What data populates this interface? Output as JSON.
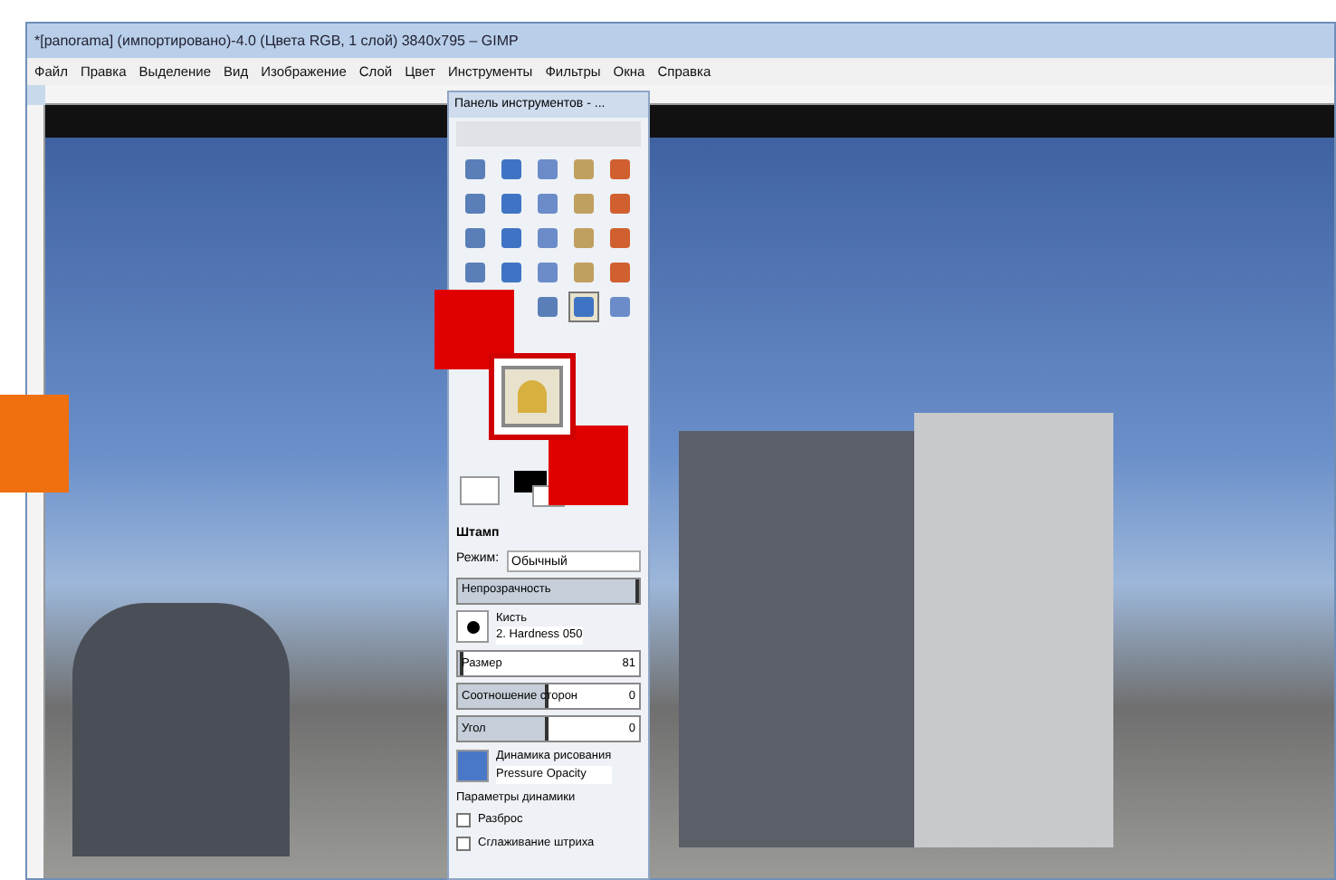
{
  "window": {
    "title": "*[panorama] (импортировано)-4.0 (Цвета RGB, 1 слой) 3840x795 – GIMP"
  },
  "menu": [
    "Файл",
    "Правка",
    "Выделение",
    "Вид",
    "Изображение",
    "Слой",
    "Цвет",
    "Инструменты",
    "Фильтры",
    "Окна",
    "Справка"
  ],
  "toolbox": {
    "title": "Панель инструментов - ...",
    "tools": [
      {
        "selected": false
      },
      {
        "selected": false
      },
      {
        "selected": false
      },
      {
        "selected": false
      },
      {
        "selected": false
      },
      {
        "selected": false
      },
      {
        "selected": false
      },
      {
        "selected": false
      },
      {
        "selected": false
      },
      {
        "selected": false
      },
      {
        "selected": false
      },
      {
        "selected": false
      },
      {
        "selected": false
      },
      {
        "selected": false
      },
      {
        "selected": false
      },
      {
        "selected": false
      },
      {
        "selected": false
      },
      {
        "selected": false
      },
      {
        "selected": false
      },
      {
        "selected": false
      },
      {
        "selected": false
      },
      {
        "selected": true
      },
      {
        "selected": false
      }
    ],
    "tool_options": {
      "title": "Штамп",
      "mode_label": "Режим:",
      "mode_value": "Обычный",
      "rows": [
        {
          "kind": "slider",
          "label": "Непрозрачность",
          "level": 1
        },
        {
          "kind": "brush",
          "label": "Кисть",
          "value": "2. Hardness 050"
        },
        {
          "kind": "slider",
          "label": "Размер",
          "level": 0.03,
          "reading": "81"
        },
        {
          "kind": "slider",
          "label": "Соотношение сторон",
          "level": 0.5,
          "reading": "0"
        },
        {
          "kind": "slider",
          "label": "Угол",
          "level": 0.5,
          "reading": "0"
        },
        {
          "kind": "dynamics",
          "label": "Динамика рисования",
          "value": "Pressure Opacity"
        },
        {
          "kind": "expander",
          "label": "Параметры динамики"
        },
        {
          "kind": "check",
          "label": "Разброс",
          "checked": false
        },
        {
          "kind": "check",
          "label": "Сглаживание штриха",
          "checked": false
        }
      ]
    }
  }
}
